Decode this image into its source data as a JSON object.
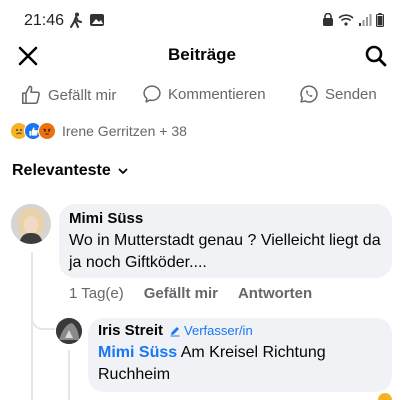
{
  "status_bar": {
    "time": "21:46",
    "left_icons": [
      "walking-icon",
      "image-icon"
    ],
    "right_icons": [
      "lock-icon",
      "wifi-icon",
      "signal-icon",
      "battery-icon"
    ]
  },
  "header": {
    "title": "Beiträge",
    "close_icon": "close-icon",
    "search_icon": "search-icon"
  },
  "actions": {
    "like": "Gefällt mir",
    "comment": "Kommentieren",
    "share": "Senden"
  },
  "reactions": {
    "types": [
      "sad",
      "like",
      "angry"
    ],
    "summary": "Irene Gerritzen + 38"
  },
  "sort": {
    "label": "Relevanteste"
  },
  "comments": [
    {
      "author": "Mimi Süss",
      "text": "Wo in Mutterstadt genau ? Vielleicht liegt da ja noch Giftköder....",
      "time": "1 Tag(e)",
      "like_label": "Gefällt mir",
      "reply_label": "Antworten"
    }
  ],
  "reply": {
    "author": "Iris Streit",
    "badge": "Verfasser/in",
    "mention": "Mimi Süss",
    "text": " Am Kreisel Richtung Ruchheim"
  },
  "colors": {
    "accent": "#1877f2",
    "muted": "#65676b",
    "bubble": "#f0f2f5"
  }
}
